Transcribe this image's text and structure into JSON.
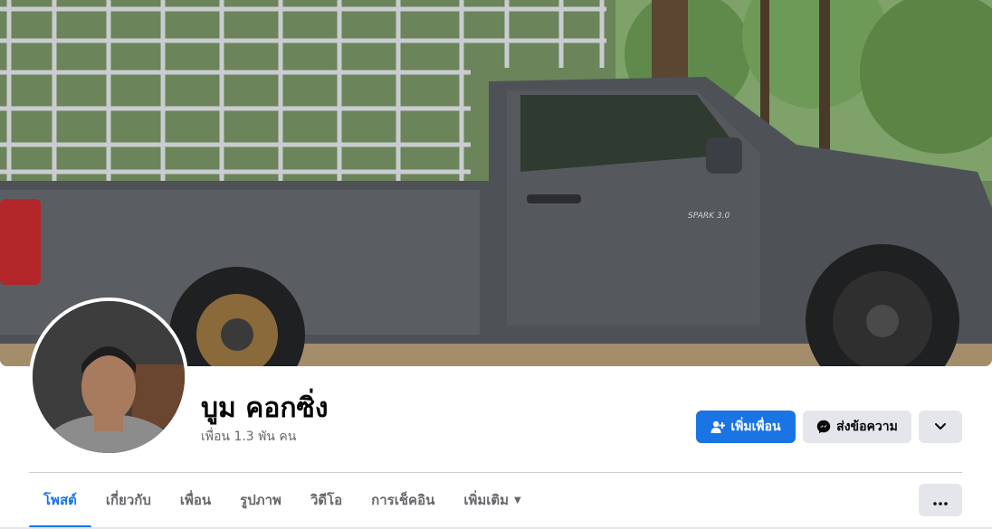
{
  "profile": {
    "name": "บูม คอกซิ่ง",
    "friends_count": "เพื่อน 1.3 พัน คน"
  },
  "actions": {
    "add_friend_label": "เพิ่มเพื่อน",
    "message_label": "ส่งข้อความ"
  },
  "tabs": [
    {
      "label": "โพสต์",
      "active": true
    },
    {
      "label": "เกี่ยวกับ"
    },
    {
      "label": "เพื่อน"
    },
    {
      "label": "รูปภาพ"
    },
    {
      "label": "วิดีโอ"
    },
    {
      "label": "การเช็คอิน"
    },
    {
      "label": "เพิ่มเติม"
    }
  ],
  "cover": {
    "badge_text": "SPARK 3.0"
  },
  "colors": {
    "accent": "#1b74e4",
    "secondary_button": "#e4e6eb",
    "muted_text": "#65676b"
  }
}
